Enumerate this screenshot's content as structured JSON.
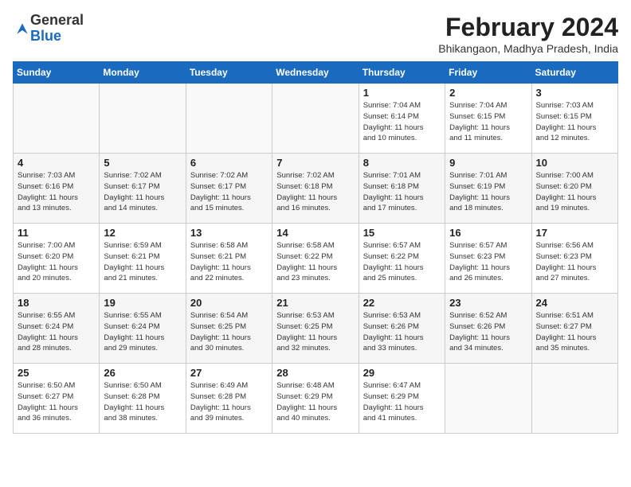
{
  "logo": {
    "general": "General",
    "blue": "Blue"
  },
  "header": {
    "month_year": "February 2024",
    "location": "Bhikangaon, Madhya Pradesh, India"
  },
  "days_of_week": [
    "Sunday",
    "Monday",
    "Tuesday",
    "Wednesday",
    "Thursday",
    "Friday",
    "Saturday"
  ],
  "weeks": [
    [
      {
        "num": "",
        "info": ""
      },
      {
        "num": "",
        "info": ""
      },
      {
        "num": "",
        "info": ""
      },
      {
        "num": "",
        "info": ""
      },
      {
        "num": "1",
        "info": "Sunrise: 7:04 AM\nSunset: 6:14 PM\nDaylight: 11 hours\nand 10 minutes."
      },
      {
        "num": "2",
        "info": "Sunrise: 7:04 AM\nSunset: 6:15 PM\nDaylight: 11 hours\nand 11 minutes."
      },
      {
        "num": "3",
        "info": "Sunrise: 7:03 AM\nSunset: 6:15 PM\nDaylight: 11 hours\nand 12 minutes."
      }
    ],
    [
      {
        "num": "4",
        "info": "Sunrise: 7:03 AM\nSunset: 6:16 PM\nDaylight: 11 hours\nand 13 minutes."
      },
      {
        "num": "5",
        "info": "Sunrise: 7:02 AM\nSunset: 6:17 PM\nDaylight: 11 hours\nand 14 minutes."
      },
      {
        "num": "6",
        "info": "Sunrise: 7:02 AM\nSunset: 6:17 PM\nDaylight: 11 hours\nand 15 minutes."
      },
      {
        "num": "7",
        "info": "Sunrise: 7:02 AM\nSunset: 6:18 PM\nDaylight: 11 hours\nand 16 minutes."
      },
      {
        "num": "8",
        "info": "Sunrise: 7:01 AM\nSunset: 6:18 PM\nDaylight: 11 hours\nand 17 minutes."
      },
      {
        "num": "9",
        "info": "Sunrise: 7:01 AM\nSunset: 6:19 PM\nDaylight: 11 hours\nand 18 minutes."
      },
      {
        "num": "10",
        "info": "Sunrise: 7:00 AM\nSunset: 6:20 PM\nDaylight: 11 hours\nand 19 minutes."
      }
    ],
    [
      {
        "num": "11",
        "info": "Sunrise: 7:00 AM\nSunset: 6:20 PM\nDaylight: 11 hours\nand 20 minutes."
      },
      {
        "num": "12",
        "info": "Sunrise: 6:59 AM\nSunset: 6:21 PM\nDaylight: 11 hours\nand 21 minutes."
      },
      {
        "num": "13",
        "info": "Sunrise: 6:58 AM\nSunset: 6:21 PM\nDaylight: 11 hours\nand 22 minutes."
      },
      {
        "num": "14",
        "info": "Sunrise: 6:58 AM\nSunset: 6:22 PM\nDaylight: 11 hours\nand 23 minutes."
      },
      {
        "num": "15",
        "info": "Sunrise: 6:57 AM\nSunset: 6:22 PM\nDaylight: 11 hours\nand 25 minutes."
      },
      {
        "num": "16",
        "info": "Sunrise: 6:57 AM\nSunset: 6:23 PM\nDaylight: 11 hours\nand 26 minutes."
      },
      {
        "num": "17",
        "info": "Sunrise: 6:56 AM\nSunset: 6:23 PM\nDaylight: 11 hours\nand 27 minutes."
      }
    ],
    [
      {
        "num": "18",
        "info": "Sunrise: 6:55 AM\nSunset: 6:24 PM\nDaylight: 11 hours\nand 28 minutes."
      },
      {
        "num": "19",
        "info": "Sunrise: 6:55 AM\nSunset: 6:24 PM\nDaylight: 11 hours\nand 29 minutes."
      },
      {
        "num": "20",
        "info": "Sunrise: 6:54 AM\nSunset: 6:25 PM\nDaylight: 11 hours\nand 30 minutes."
      },
      {
        "num": "21",
        "info": "Sunrise: 6:53 AM\nSunset: 6:25 PM\nDaylight: 11 hours\nand 32 minutes."
      },
      {
        "num": "22",
        "info": "Sunrise: 6:53 AM\nSunset: 6:26 PM\nDaylight: 11 hours\nand 33 minutes."
      },
      {
        "num": "23",
        "info": "Sunrise: 6:52 AM\nSunset: 6:26 PM\nDaylight: 11 hours\nand 34 minutes."
      },
      {
        "num": "24",
        "info": "Sunrise: 6:51 AM\nSunset: 6:27 PM\nDaylight: 11 hours\nand 35 minutes."
      }
    ],
    [
      {
        "num": "25",
        "info": "Sunrise: 6:50 AM\nSunset: 6:27 PM\nDaylight: 11 hours\nand 36 minutes."
      },
      {
        "num": "26",
        "info": "Sunrise: 6:50 AM\nSunset: 6:28 PM\nDaylight: 11 hours\nand 38 minutes."
      },
      {
        "num": "27",
        "info": "Sunrise: 6:49 AM\nSunset: 6:28 PM\nDaylight: 11 hours\nand 39 minutes."
      },
      {
        "num": "28",
        "info": "Sunrise: 6:48 AM\nSunset: 6:29 PM\nDaylight: 11 hours\nand 40 minutes."
      },
      {
        "num": "29",
        "info": "Sunrise: 6:47 AM\nSunset: 6:29 PM\nDaylight: 11 hours\nand 41 minutes."
      },
      {
        "num": "",
        "info": ""
      },
      {
        "num": "",
        "info": ""
      }
    ]
  ]
}
